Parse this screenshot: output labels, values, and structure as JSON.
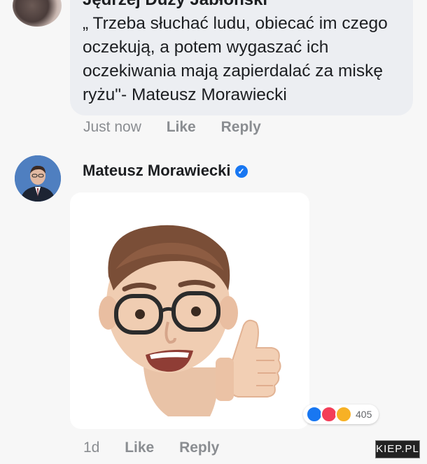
{
  "comment1": {
    "author": "Jędrzej Duży Jabłoński",
    "text": "„ Trzeba słuchać ludu, obiecać im czego oczekują, a potem wygaszać ich oczekiwania mają zapierdalać za miskę ryżu\"- Mateusz Morawiecki",
    "time": "Just now",
    "like_label": "Like",
    "reply_label": "Reply"
  },
  "comment2": {
    "author": "Mateusz Morawiecki",
    "verified": true,
    "media": "memoji-thumbs-up",
    "reactions": {
      "icons": [
        "like-reaction-icon",
        "love-reaction-icon",
        "haha-reaction-icon"
      ],
      "count": "405"
    },
    "time": "1d",
    "like_label": "Like",
    "reply_label": "Reply"
  },
  "watermark": "KIEP.PL",
  "colors": {
    "bubble": "#eceef2",
    "meta_text": "#8a8d91",
    "verified_blue": "#1877f2"
  }
}
